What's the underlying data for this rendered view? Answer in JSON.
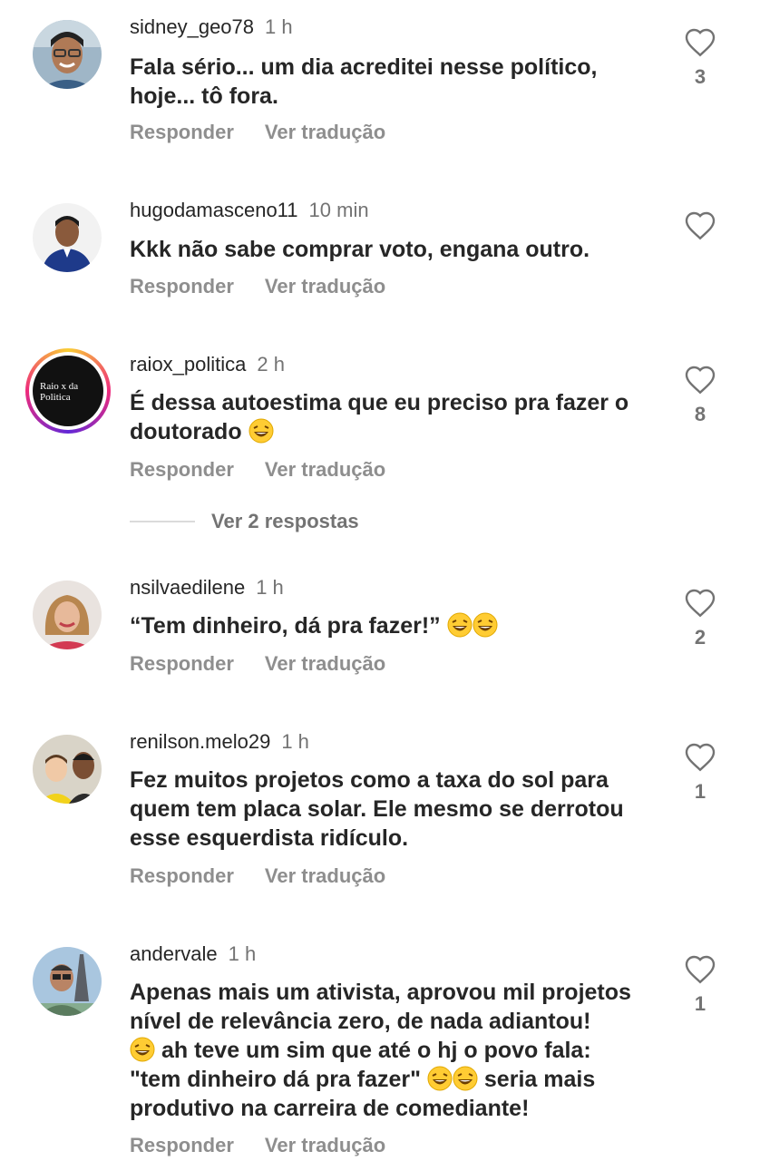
{
  "comments": [
    {
      "user": "sidney_geo78",
      "time": "1 h",
      "text": "Fala sério... um dia acreditei nesse político, hoje... tô fora.",
      "likes": "3",
      "reply": "Responder",
      "translate": "Ver tradução",
      "avatar_icon": "man-glasses-avatar"
    },
    {
      "user": "hugodamasceno11",
      "time": "10 min",
      "text": "Kkk não sabe comprar voto, engana outro.",
      "likes": "",
      "reply": "Responder",
      "translate": "Ver tradução",
      "avatar_icon": "man-shirt-avatar"
    },
    {
      "user": "raiox_politica",
      "time": "2 h",
      "text": "É dessa autoestima que eu preciso pra fazer o doutorado",
      "likes": "8",
      "reply": "Responder",
      "translate": "Ver tradução",
      "avatar_text": "Raio x da Politica"
    },
    {
      "user": "nsilvaedilene",
      "time": "1 h",
      "text": "“Tem dinheiro, dá pra fazer!”",
      "likes": "2",
      "reply": "Responder",
      "translate": "Ver tradução",
      "avatar_icon": "woman-avatar"
    },
    {
      "user": "renilson.melo29",
      "time": "1 h",
      "text": "Fez muitos projetos como a taxa do sol para quem tem placa solar. Ele mesmo se derrotou esse esquerdista ridículo.",
      "likes": "1",
      "reply": "Responder",
      "translate": "Ver tradução",
      "avatar_icon": "man-child-avatar"
    },
    {
      "user": "andervale",
      "time": "1 h",
      "text_parts": [
        "Apenas mais um ativista, aprovou mil projetos nível de relevância zero, de nada adiantou!",
        "ah teve um sim que até o hj o povo fala: \"tem dinheiro dá pra fazer\"",
        "seria mais produtivo na carreira de comediante!"
      ],
      "likes": "1",
      "reply": "Responder",
      "translate": "Ver tradução",
      "avatar_icon": "man-eiffel-avatar"
    }
  ],
  "view_replies": "Ver 2 respostas",
  "colors": {
    "username": "#262626",
    "muted": "#737373",
    "action": "#8e8e8e",
    "story_ring_start": "#f9ce34",
    "story_ring_mid": "#ee2a7b",
    "story_ring_end": "#6228d7"
  },
  "icons": {
    "like": "heart-outline-icon",
    "emoji": "laughing-emoji"
  }
}
